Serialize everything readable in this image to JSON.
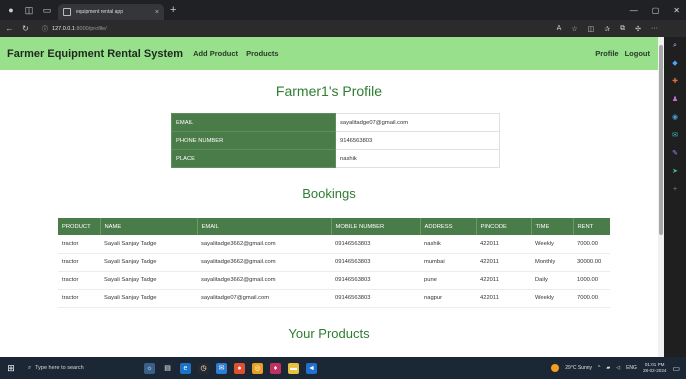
{
  "browser": {
    "tab_title": "equipment rental app",
    "tab_close": "×",
    "new_tab": "+",
    "url_host": "127.0.0.1",
    "url_path": ":8000/profile/",
    "window_controls": [
      "—",
      "▢",
      "✕"
    ]
  },
  "nav": {
    "brand": "Farmer Equipment Rental System",
    "links": [
      "Add Product",
      "Products"
    ],
    "right_links": [
      "Profile",
      "Logout"
    ]
  },
  "profile": {
    "title": "Farmer1's Profile",
    "rows": [
      {
        "label": "EMAIL",
        "value": "sayalitadge07@gmail.com"
      },
      {
        "label": "PHONE NUMBER",
        "value": "9146563803"
      },
      {
        "label": "PLACE",
        "value": "nashik"
      }
    ]
  },
  "bookings": {
    "title": "Bookings",
    "columns": [
      "PRODUCT",
      "NAME",
      "EMAIL",
      "MOBILE NUMBER",
      "ADDRESS",
      "PINCODE",
      "TIME",
      "RENT"
    ],
    "rows": [
      [
        "tractor",
        "Sayali Sanjay Tadge",
        "sayalitadge3662@gmail.com",
        "09146563803",
        "nashik",
        "422011",
        "Weekly",
        "7000.00"
      ],
      [
        "tractor",
        "Sayali Sanjay Tadge",
        "sayalitadge3662@gmail.com",
        "09146563803",
        "mumbai",
        "422011",
        "Monthly",
        "30000.00"
      ],
      [
        "tractor",
        "Sayali Sanjay Tadge",
        "sayalitadge3662@gmail.com",
        "09146563803",
        "pune",
        "422011",
        "Daily",
        "1000.00"
      ],
      [
        "tractor",
        "Sayali Sanjay Tadge",
        "sayalitadge07@gmail.com",
        "09146563803",
        "nagpur",
        "422011",
        "Weekly",
        "7000.00"
      ]
    ]
  },
  "products": {
    "title": "Your Products"
  },
  "taskbar": {
    "search_placeholder": "Type here to search",
    "weather": "29°C  Sunny",
    "lang": "ENG",
    "time": "01:01 PM",
    "date": "28-02-2024"
  },
  "colors": {
    "nav_bg": "#98e08c",
    "header_green": "#4a7c4a",
    "title_green": "#2e7d32"
  }
}
